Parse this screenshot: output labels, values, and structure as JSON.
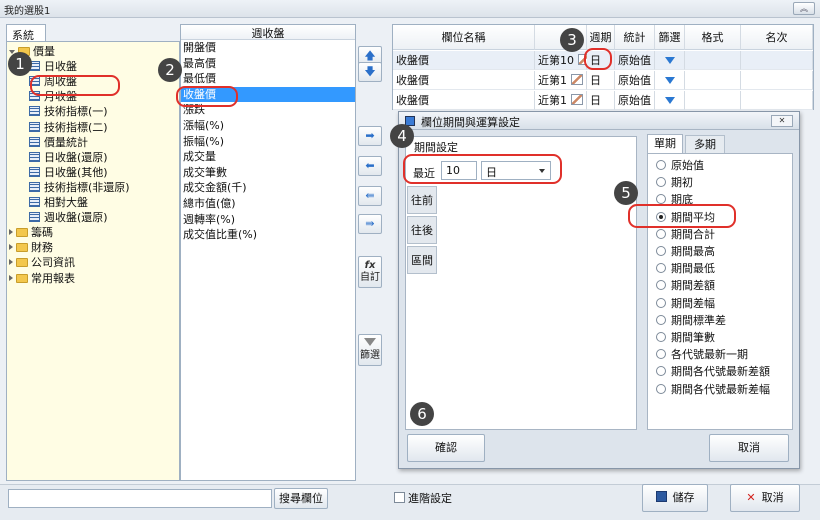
{
  "window": {
    "title": "我的選股1"
  },
  "left_tab": "系統",
  "tree": [
    {
      "label": "價量",
      "kind": "folder-open"
    },
    {
      "label": "日收盤",
      "kind": "table"
    },
    {
      "label": "周收盤",
      "kind": "table"
    },
    {
      "label": "月收盤",
      "kind": "table"
    },
    {
      "label": "技術指標(一)",
      "kind": "table"
    },
    {
      "label": "技術指標(二)",
      "kind": "table"
    },
    {
      "label": "價量統計",
      "kind": "table"
    },
    {
      "label": "日收盤(還原)",
      "kind": "table"
    },
    {
      "label": "日收盤(其他)",
      "kind": "table"
    },
    {
      "label": "技術指標(非還原)",
      "kind": "table"
    },
    {
      "label": "相對大盤",
      "kind": "table"
    },
    {
      "label": "週收盤(還原)",
      "kind": "table"
    },
    {
      "label": "籌碼",
      "kind": "folder"
    },
    {
      "label": "財務",
      "kind": "folder"
    },
    {
      "label": "公司資訊",
      "kind": "folder"
    },
    {
      "label": "常用報表",
      "kind": "folder"
    }
  ],
  "field_list": {
    "header": "週收盤",
    "items": [
      "開盤價",
      "最高價",
      "最低價",
      "收盤價",
      "漲跌",
      "漲幅(%)",
      "振幅(%)",
      "成交量",
      "成交筆數",
      "成交金額(千)",
      "總市值(億)",
      "週轉率(%)",
      "成交值比重(%)"
    ],
    "selected": 3
  },
  "middle_buttons": {
    "formula_label": "自訂",
    "formula_icon": "fx",
    "filter_label": "篩選"
  },
  "grid": {
    "headers": [
      "欄位名稱",
      "",
      "週期",
      "統計",
      "篩選",
      "格式",
      "名次"
    ],
    "rows": [
      {
        "name": "收盤價",
        "range": "近第10",
        "period": "日",
        "stat": "原始值"
      },
      {
        "name": "收盤價",
        "range": "近第1",
        "period": "日",
        "stat": "原始值"
      },
      {
        "name": "收盤價",
        "range": "近第1",
        "period": "日",
        "stat": "原始值"
      }
    ]
  },
  "dialog": {
    "title": "欄位期間與運算設定",
    "period_section": "期間設定",
    "recent_label": "最近",
    "recent_value": "10",
    "unit_value": "日",
    "side_tabs": [
      "往前",
      "往後",
      "區間"
    ],
    "right_tabs": [
      "單期",
      "多期"
    ],
    "options": [
      "原始值",
      "期初",
      "期底",
      "期間平均",
      "期間合計",
      "期間最高",
      "期間最低",
      "期間差額",
      "期間差幅",
      "期間標準差",
      "期間筆數",
      "各代號最新一期",
      "期間各代號最新差額",
      "期間各代號最新差幅"
    ],
    "selected_option": "期間平均",
    "confirm": "確認",
    "cancel": "取消"
  },
  "bottom": {
    "search_placeholder": "",
    "search_button": "搜尋欄位",
    "advanced_label": "進階設定",
    "save_label": "儲存",
    "cancel_label": "取消"
  },
  "annotations": [
    "1",
    "2",
    "3",
    "4",
    "5",
    "6"
  ],
  "colors": {
    "annotation_ring": "#e0302a",
    "selection": "#3399ff",
    "tree_bg": "#fffde4"
  }
}
